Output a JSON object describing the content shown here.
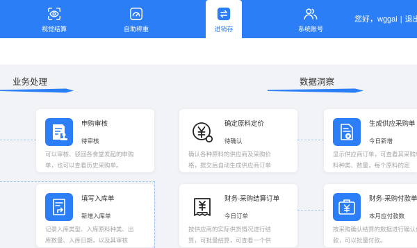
{
  "header": {
    "nav": [
      {
        "label": "视觉结算",
        "icon": "scan-eye-icon"
      },
      {
        "label": "自助称重",
        "icon": "scale-icon"
      },
      {
        "label": "进销存",
        "icon": "swap-icon",
        "active": true
      },
      {
        "label": "系统账号",
        "icon": "users-icon"
      }
    ],
    "greeting": "您好，wggai",
    "separator": "|",
    "logout": "退出"
  },
  "sections": {
    "business": {
      "title": "业务处理"
    },
    "insight": {
      "title": "数据洞察"
    }
  },
  "cards": [
    {
      "title": "申购审核",
      "status": "待审核",
      "icon": "document-stamp-icon",
      "desc": [
        "可以审核、驳回各食堂发起的申购",
        "单，也可以查看历史采购单。"
      ]
    },
    {
      "title": "确定原料定价",
      "status": "待确认",
      "icon": "yen-coin-icon",
      "desc": [
        "确认各种原料的供应商及采购价",
        "格，提交后自动生成供应商订单"
      ]
    },
    {
      "title": "生成供应采购单",
      "status": "今日新增",
      "icon": "supplier-document-icon",
      "desc": [
        "显示供应商订单，可查看其采购单原",
        "料种类、数量，每个原料的定"
      ]
    },
    {
      "title": "填写入库单",
      "status": "新增入库单",
      "icon": "inbound-document-icon",
      "desc": [
        "记录入库类型、入库原料种类、出",
        "库数量、入库日期，以及其审核"
      ]
    },
    {
      "title": "财务-采购结算订单",
      "status": "今日订单",
      "icon": "yen-receipt-icon",
      "desc": [
        "按供应商的实际供货情况进行结",
        "算，可批量结算，可查看一个供"
      ]
    },
    {
      "title": "财务-采购付款单",
      "status": "本月应付款数",
      "icon": "yen-bag-icon",
      "desc": [
        "按采购确认结算的数据进行确认付",
        "款，可以批量付款。"
      ]
    }
  ],
  "colors": {
    "primary": "#2b7ef6",
    "background": "#f2f3f6",
    "title_text": "#333333",
    "desc_text": "#a6a6a6",
    "connector": "#9fc4f5"
  }
}
